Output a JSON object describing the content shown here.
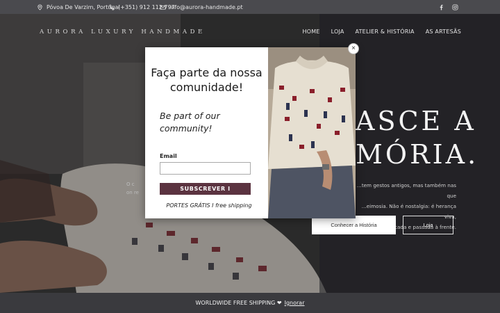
{
  "topbar": {
    "location": "Póvoa De Varzim, Portugal",
    "phone": "(+351) 912 112 797",
    "email": "info@aurora-handmade.pt",
    "social": [
      "facebook-icon",
      "instagram-icon"
    ]
  },
  "nav": {
    "brand": "AURORA LUXURY HANDMADE",
    "links": [
      "HOME",
      "LOJA",
      "ATELIER & HISTÓRIA",
      "AS ARTESÃS"
    ]
  },
  "hero": {
    "title_line1": "ASCE A",
    "title_line2": "MÓRIA.",
    "text_line1": "…tem gestos antigos, mas também nas que",
    "text_line2": "…eimosia.  Não é nostalgia: é herança viva,",
    "text_line3": "usada, tocada e passada à frente.",
    "left_bit1": "O c",
    "left_bit2": "on re",
    "button_story": "Conhecer a História",
    "button_shop": "Loja"
  },
  "popup": {
    "title": "Faça parte da nossa comunidade!",
    "subtitle": "Be part of our community!",
    "email_label": "Email",
    "email_value": "",
    "subscribe_label": "SUBSCREVER I",
    "shipping_note": "PORTES GRÁTIS I free shipping",
    "close_symbol": "×"
  },
  "bottombar": {
    "message": "WORLDWIDE  FREE SHIPPING ❤",
    "dismiss": "Ignorar"
  },
  "colors": {
    "accent": "#5b3340",
    "topbar": "#4a4a4e",
    "bottombar": "#3a3a3e"
  }
}
